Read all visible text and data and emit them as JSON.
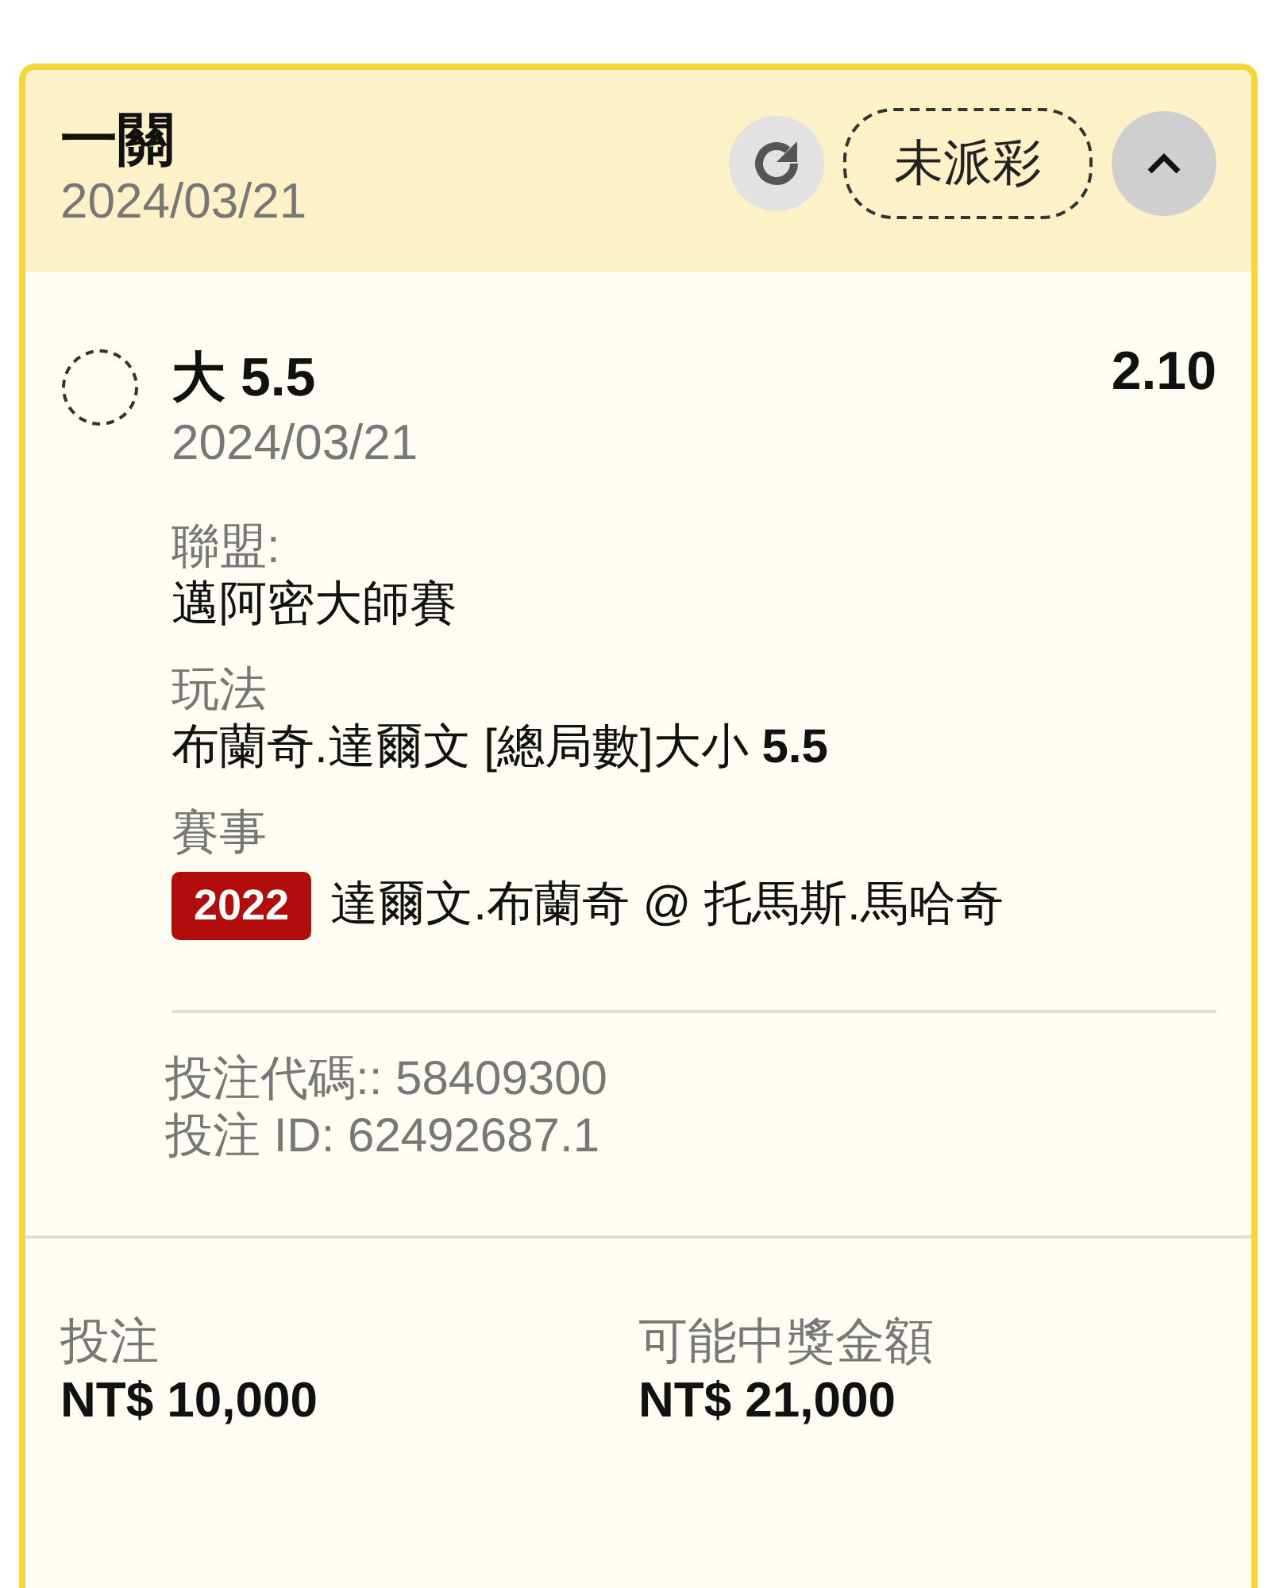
{
  "card": {
    "title": "一關",
    "date": "2024/03/21",
    "status": "未派彩",
    "expanded": true
  },
  "selection": {
    "name": "大 5.5",
    "date": "2024/03/21",
    "odds": "2.10",
    "details": [
      {
        "label": "聯盟:",
        "value": "邁阿密大師賽"
      },
      {
        "label": "玩法",
        "value": "布蘭奇.達爾文 [總局數]大小 **5.5**"
      },
      {
        "label": "賽事",
        "badge": "2022",
        "value": "達爾文.布蘭奇 @ 托馬斯.馬哈奇"
      }
    ],
    "codes": [
      "投注代碼:: 58409300",
      "投注 ID: 62492687.1"
    ]
  },
  "totals": [
    {
      "label": "投注",
      "amount": "NT$ 10,000"
    },
    {
      "label": "可能中獎金額",
      "amount": "NT$ 21,000"
    }
  ]
}
